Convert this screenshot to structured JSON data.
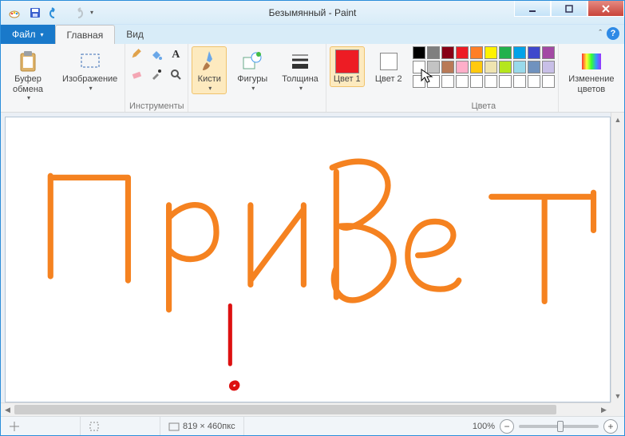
{
  "title": "Безымянный - Paint",
  "tabs": {
    "file": "Файл",
    "home": "Главная",
    "view": "Вид"
  },
  "groups": {
    "clipboard": {
      "label": "Буфер обмена",
      "paste": ""
    },
    "image": {
      "label": "Изображение",
      "btn": ""
    },
    "tools": {
      "label": "Инструменты"
    },
    "brushes": {
      "label": "Кисти"
    },
    "shapes": {
      "label": "Фигуры"
    },
    "size": {
      "label": "Толщина"
    },
    "color1": {
      "label": "Цвет 1"
    },
    "color2": {
      "label": "Цвет 2"
    },
    "colors": {
      "label": "Цвета"
    },
    "edit_colors": {
      "label": "Изменение цветов"
    }
  },
  "palette_row1": [
    "#000000",
    "#7f7f7f",
    "#880015",
    "#ed1c24",
    "#ff7f27",
    "#fff200",
    "#22b14c",
    "#00a2e8",
    "#3f48cc",
    "#a349a4"
  ],
  "palette_row2": [
    "#ffffff",
    "#c3c3c3",
    "#b97a57",
    "#ffaec9",
    "#ffc90e",
    "#efe4b0",
    "#b5e61d",
    "#99d9ea",
    "#7092be",
    "#c8bfe7"
  ],
  "palette_row3": [
    "#ffffff",
    "#ffffff",
    "#ffffff",
    "#ffffff",
    "#ffffff",
    "#ffffff",
    "#ffffff",
    "#ffffff",
    "#ffffff",
    "#ffffff"
  ],
  "current_color1": "#ed1c24",
  "current_color2": "#ffffff",
  "status": {
    "dimensions": "819 × 460пкс",
    "zoom": "100%"
  }
}
